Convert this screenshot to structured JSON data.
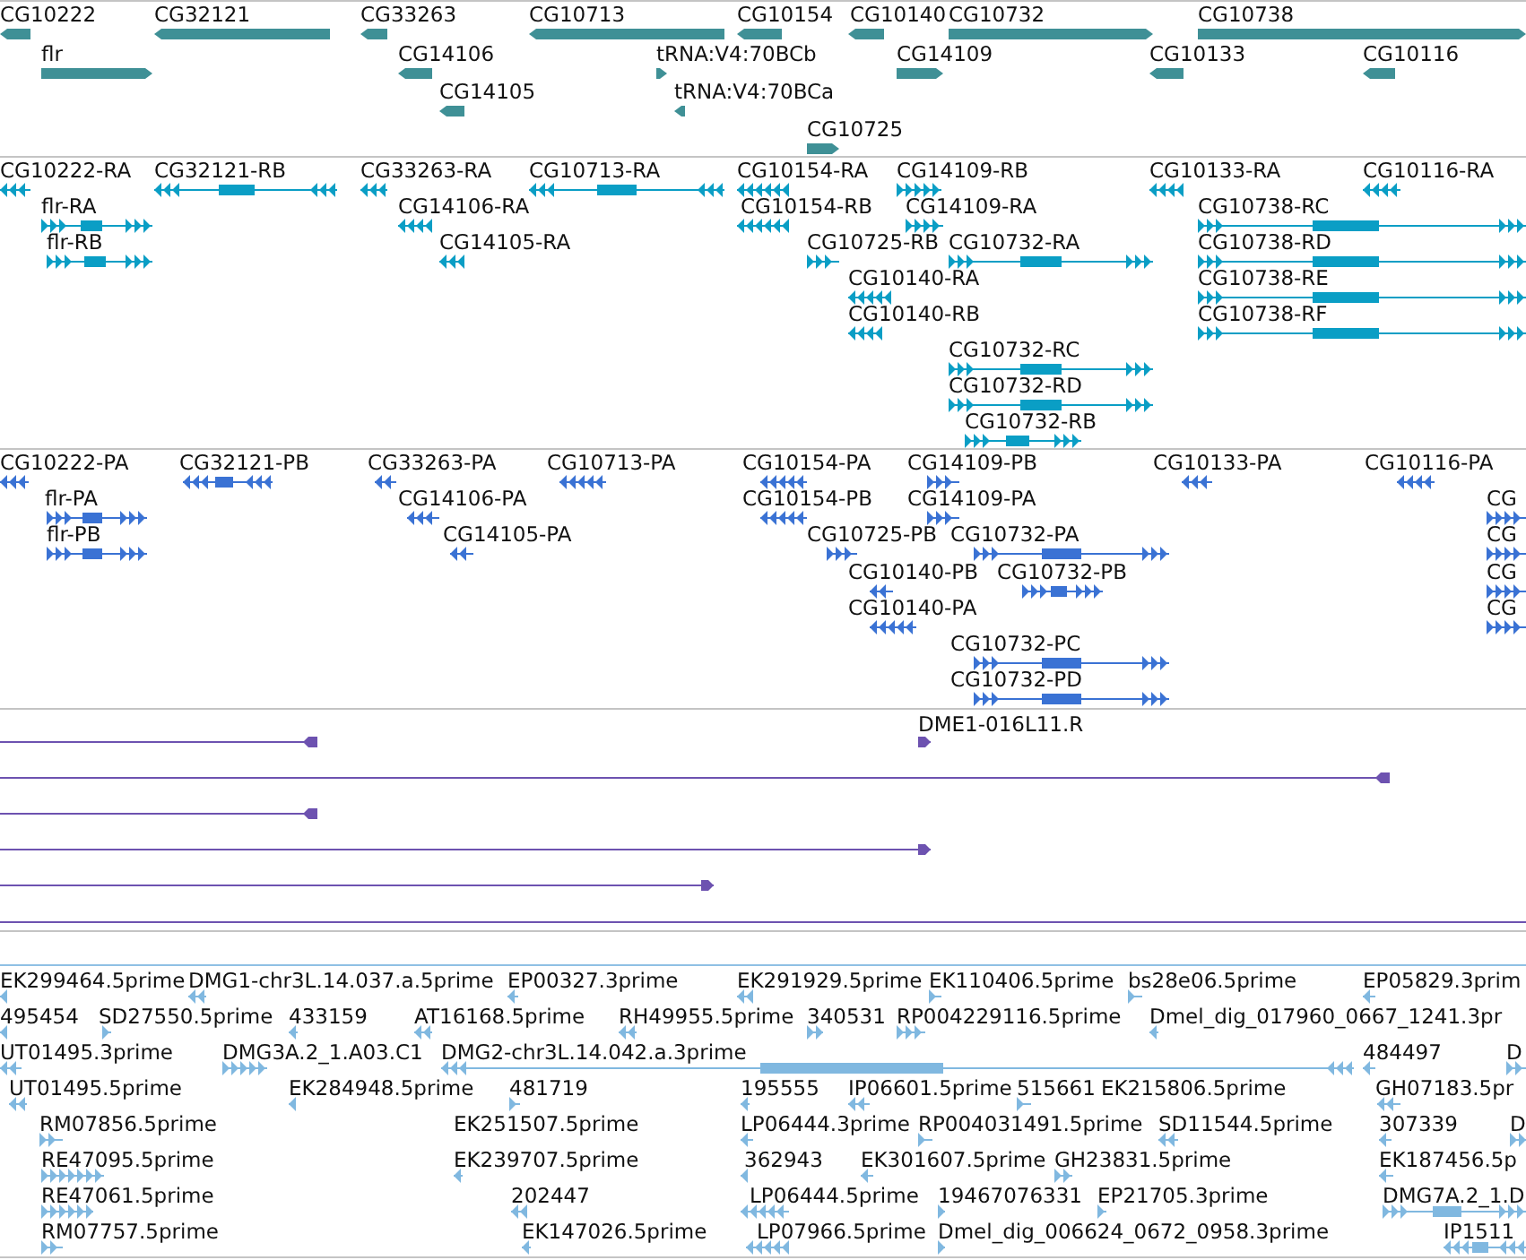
{
  "tracks": [
    {
      "kind": "gene",
      "features": [
        {
          "label": "CG10222",
          "reverse": true
        },
        {
          "label": "CG32121",
          "reverse": true
        },
        {
          "label": "CG33263",
          "reverse": true
        },
        {
          "label": "CG10713",
          "reverse": true
        },
        {
          "label": "CG10154",
          "reverse": true
        },
        {
          "label": "CG10140",
          "reverse": true
        },
        {
          "label": "CG10732",
          "reverse": false
        },
        {
          "label": "CG10738",
          "reverse": false
        },
        {
          "label": "flr",
          "reverse": false
        },
        {
          "label": "CG14106",
          "reverse": true
        },
        {
          "label": "tRNA:V4:70BCb",
          "reverse": false
        },
        {
          "label": "CG14109",
          "reverse": false
        },
        {
          "label": "CG10133",
          "reverse": true
        },
        {
          "label": "CG10116",
          "reverse": true
        },
        {
          "label": "CG14105",
          "reverse": true
        },
        {
          "label": "tRNA:V4:70BCa",
          "reverse": true
        },
        {
          "label": "CG10725",
          "reverse": false
        }
      ]
    },
    {
      "kind": "transcript",
      "features": [
        {
          "label": "CG10222-RA",
          "reverse": true
        },
        {
          "label": "CG32121-RB",
          "reverse": true
        },
        {
          "label": "CG33263-RA",
          "reverse": true
        },
        {
          "label": "CG10713-RA",
          "reverse": true
        },
        {
          "label": "CG10154-RA",
          "reverse": true
        },
        {
          "label": "CG14109-RB",
          "reverse": false
        },
        {
          "label": "CG10133-RA",
          "reverse": true
        },
        {
          "label": "CG10116-RA",
          "reverse": true
        },
        {
          "label": "flr-RA",
          "reverse": false
        },
        {
          "label": "CG14106-RA",
          "reverse": true
        },
        {
          "label": "CG10154-RB",
          "reverse": true
        },
        {
          "label": "CG14109-RA",
          "reverse": false
        },
        {
          "label": "CG10738-RC",
          "reverse": false
        },
        {
          "label": "flr-RB",
          "reverse": false
        },
        {
          "label": "CG14105-RA",
          "reverse": true
        },
        {
          "label": "CG10725-RB",
          "reverse": false
        },
        {
          "label": "CG10732-RA",
          "reverse": false
        },
        {
          "label": "CG10738-RD",
          "reverse": false
        },
        {
          "label": "CG10140-RA",
          "reverse": true
        },
        {
          "label": "CG10738-RE",
          "reverse": false
        },
        {
          "label": "CG10140-RB",
          "reverse": true
        },
        {
          "label": "CG10738-RF",
          "reverse": false
        },
        {
          "label": "CG10732-RC",
          "reverse": false
        },
        {
          "label": "CG10732-RD",
          "reverse": false
        },
        {
          "label": "CG10732-RB",
          "reverse": false
        }
      ]
    },
    {
      "kind": "protein",
      "features": [
        {
          "label": "CG10222-PA",
          "reverse": true
        },
        {
          "label": "CG32121-PB",
          "reverse": true
        },
        {
          "label": "CG33263-PA",
          "reverse": true
        },
        {
          "label": "CG10713-PA",
          "reverse": true
        },
        {
          "label": "CG10154-PA",
          "reverse": true
        },
        {
          "label": "CG14109-PB",
          "reverse": false
        },
        {
          "label": "CG10133-PA",
          "reverse": true
        },
        {
          "label": "CG10116-PA",
          "reverse": true
        },
        {
          "label": "flr-PA",
          "reverse": false
        },
        {
          "label": "CG14106-PA",
          "reverse": true
        },
        {
          "label": "CG10154-PB",
          "reverse": true
        },
        {
          "label": "CG14109-PA",
          "reverse": false
        },
        {
          "label": "CG",
          "reverse": false
        },
        {
          "label": "flr-PB",
          "reverse": false
        },
        {
          "label": "CG14105-PA",
          "reverse": true
        },
        {
          "label": "CG10725-PB",
          "reverse": false
        },
        {
          "label": "CG10732-PA",
          "reverse": false
        },
        {
          "label": "CG",
          "reverse": false
        },
        {
          "label": "CG10140-PB",
          "reverse": true
        },
        {
          "label": "CG10732-PB",
          "reverse": false
        },
        {
          "label": "CG",
          "reverse": false
        },
        {
          "label": "CG10140-PA",
          "reverse": true
        },
        {
          "label": "CG",
          "reverse": false
        },
        {
          "label": "CG10732-PC",
          "reverse": false
        },
        {
          "label": "CG10732-PD",
          "reverse": false
        }
      ]
    },
    {
      "kind": "clone",
      "features": [
        {
          "reverse": true
        },
        {
          "label": "DME1-016L11.R",
          "reverse": false
        },
        {
          "reverse": true
        },
        {
          "reverse": true
        },
        {
          "reverse": false
        },
        {
          "reverse": false
        }
      ]
    },
    {
      "kind": "est",
      "features": [
        {
          "label": "EK299464.5prime",
          "reverse": true
        },
        {
          "label": "DMG1-chr3L.14.037.a.5prime",
          "reverse": true
        },
        {
          "label": "EP00327.3prime",
          "reverse": true
        },
        {
          "label": "EK291929.5prime",
          "reverse": true
        },
        {
          "label": "EK110406.5prime",
          "reverse": false
        },
        {
          "label": "bs28e06.5prime",
          "reverse": false
        },
        {
          "label": "EP05829.3prim",
          "reverse": true
        },
        {
          "label": "495454",
          "reverse": true
        },
        {
          "label": "SD27550.5prime",
          "reverse": false
        },
        {
          "label": "433159",
          "reverse": true
        },
        {
          "label": "AT16168.5prime",
          "reverse": true
        },
        {
          "label": "RH49955.5prime",
          "reverse": true
        },
        {
          "label": "340531",
          "reverse": false
        },
        {
          "label": "RP004229116.5prime",
          "reverse": false
        },
        {
          "label": "Dmel_dig_017960_0667_1241.3pr",
          "reverse": true
        },
        {
          "label": "UT01495.3prime",
          "reverse": true
        },
        {
          "label": "DMG3A.2_1.A03.C1",
          "reverse": false
        },
        {
          "label": "DMG2-chr3L.14.042.a.3prime",
          "reverse": true
        },
        {
          "label": "484497",
          "reverse": true
        },
        {
          "label": "D",
          "reverse": false
        },
        {
          "label": "UT01495.5prime",
          "reverse": true
        },
        {
          "label": "EK284948.5prime",
          "reverse": true
        },
        {
          "label": "481719",
          "reverse": false
        },
        {
          "label": "195555",
          "reverse": true
        },
        {
          "label": "IP06601.5prime",
          "reverse": true
        },
        {
          "label": "515661",
          "reverse": false
        },
        {
          "label": "EK215806.5prime"
        },
        {
          "label": "GH07183.5pr",
          "reverse": true
        },
        {
          "label": "RM07856.5prime",
          "reverse": false
        },
        {
          "label": "EK251507.5prime"
        },
        {
          "label": "LP06444.3prime",
          "reverse": true
        },
        {
          "label": "RP004031491.5prime",
          "reverse": false
        },
        {
          "label": "SD11544.5prime",
          "reverse": true
        },
        {
          "label": "307339",
          "reverse": true
        },
        {
          "label": "D",
          "reverse": false
        },
        {
          "label": "RE47095.5prime",
          "reverse": false
        },
        {
          "label": "EK239707.5prime",
          "reverse": true
        },
        {
          "label": "362943",
          "reverse": true
        },
        {
          "label": "EK301607.5prime",
          "reverse": true
        },
        {
          "label": "GH23831.5prime",
          "reverse": false
        },
        {
          "label": "EK187456.5p",
          "reverse": true
        },
        {
          "label": "RE47061.5prime",
          "reverse": false
        },
        {
          "label": "202447",
          "reverse": true
        },
        {
          "label": "LP06444.5prime",
          "reverse": true
        },
        {
          "label": "19467076331",
          "reverse": false
        },
        {
          "label": "EP21705.3prime",
          "reverse": false
        },
        {
          "label": "DMG7A.2_1.D",
          "reverse": false
        },
        {
          "label": "RM07757.5prime",
          "reverse": false
        },
        {
          "label": "EK147026.5prime",
          "reverse": true
        },
        {
          "label": "LP07966.5prime",
          "reverse": true
        },
        {
          "label": "Dmel_dig_006624_0672_0958.3prime",
          "reverse": false
        },
        {
          "label": "IP1511",
          "reverse": true
        }
      ]
    }
  ]
}
